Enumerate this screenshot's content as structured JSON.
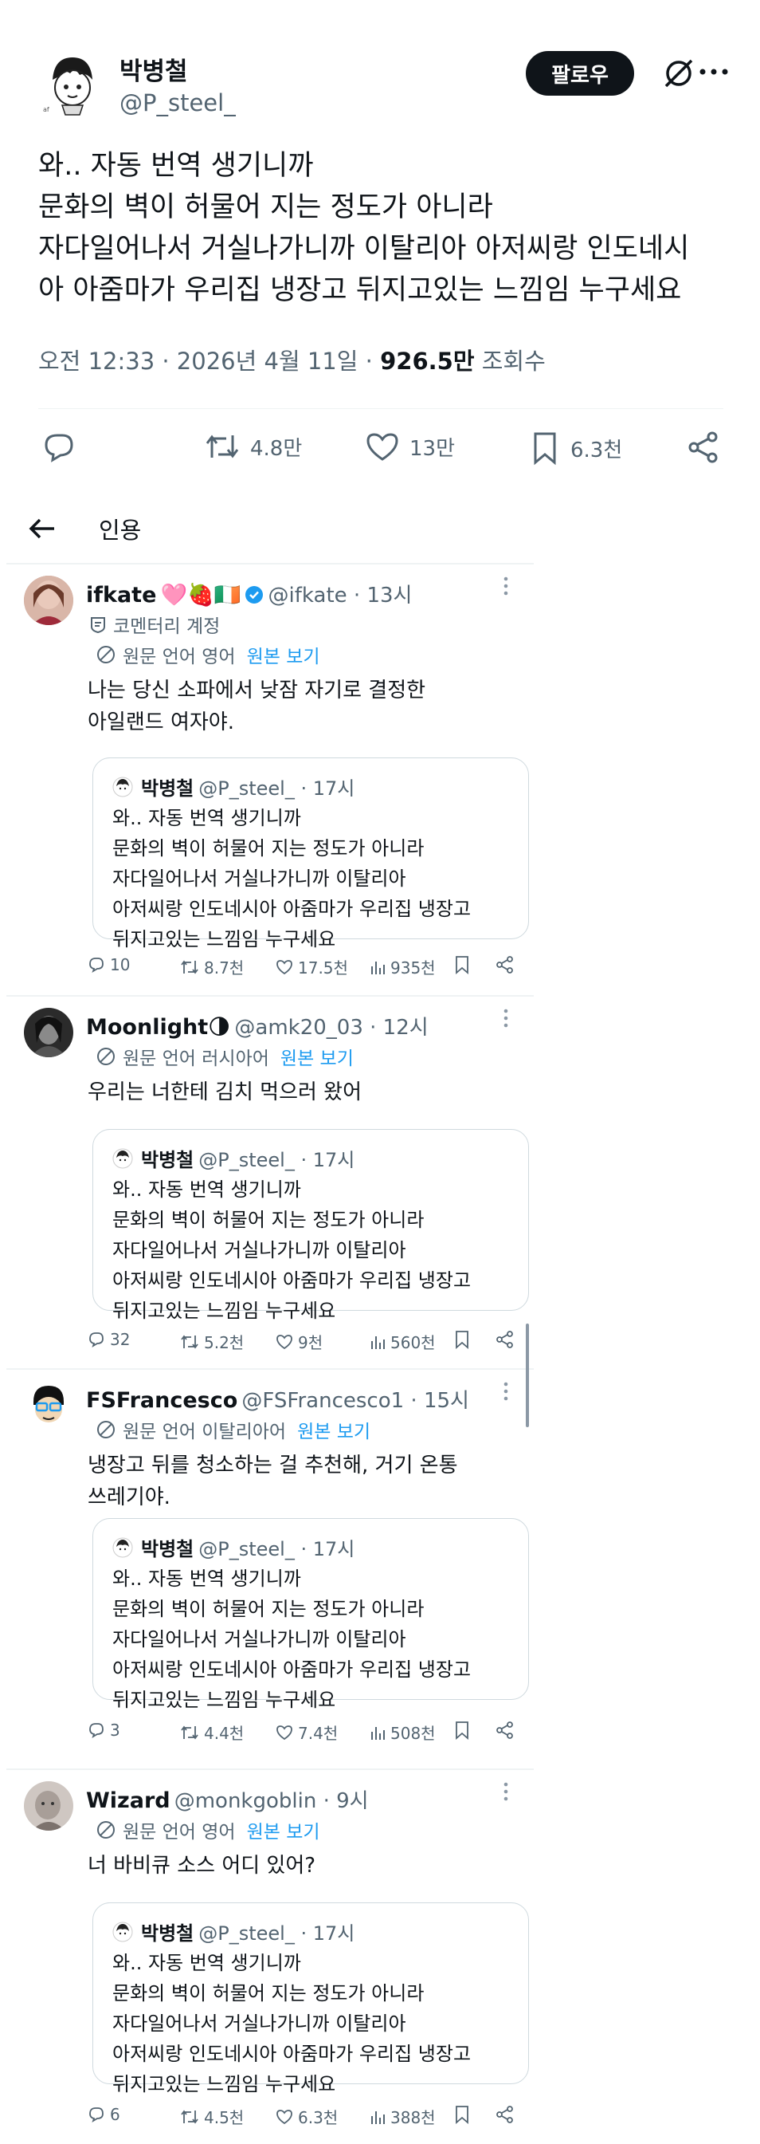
{
  "main": {
    "author_name": "박병철",
    "author_handle": "@P_steel_",
    "follow_label": "팔로우",
    "text": "와.. 자동 번역 생기니까\n문화의 벽이 허물어 지는 정도가 아니라\n자다일어나서 거실나가니까 이탈리아 아저씨랑 인도네시\n아 아줌마가 우리집 냉장고 뒤지고있는 느낌임 누구세요",
    "timestamp": "오전 12:33 · 2026년 4월 11일 · ",
    "views_count": "926.5만",
    "views_label": " 조회수",
    "retweets": "4.8만",
    "likes": "13만",
    "bookmarks": "6.3천"
  },
  "quotes_header": {
    "title": "인용"
  },
  "quoted": {
    "name": "박병철",
    "handle": "@P_steel_ · 17시",
    "text": "와.. 자동 번역 생기니까\n문화의 벽이 허물어 지는 정도가 아니라\n자다일어나서 거실나가니까 이탈리아\n아저씨랑 인도네시아 아줌마가 우리집 냉장고\n뒤지고있는 느낌임 누구세요"
  },
  "replies": [
    {
      "name": "ifkate",
      "emoji": "🩷🍓🇮🇪",
      "verified": true,
      "handle": "@ifkate · 13시",
      "subtitle": "코멘터리 계정",
      "translation": "원문 언어 영어",
      "show_original": "원본 보기",
      "text": "나는 당신 소파에서 낮잠 자기로 결정한\n아일랜드 여자야.",
      "stats": {
        "replies": "10",
        "retweets": "8.7천",
        "likes": "17.5천",
        "views": "935천"
      }
    },
    {
      "name": "Moonlight",
      "emoji": "🌗",
      "verified": false,
      "handle": "@amk20_03 · 12시",
      "translation": "원문 언어 러시아어",
      "show_original": "원본 보기",
      "text": "우리는 너한테 김치 먹으러 왔어",
      "stats": {
        "replies": "32",
        "retweets": "5.2천",
        "likes": "9천",
        "views": "560천"
      }
    },
    {
      "name": "FSFrancesco",
      "emoji": "",
      "verified": false,
      "handle": "@FSFrancesco1 · 15시",
      "translation": "원문 언어 이탈리아어",
      "show_original": "원본 보기",
      "text": "냉장고 뒤를 청소하는 걸 추천해, 거기 온통\n쓰레기야.",
      "stats": {
        "replies": "3",
        "retweets": "4.4천",
        "likes": "7.4천",
        "views": "508천"
      }
    },
    {
      "name": "Wizard",
      "emoji": "",
      "verified": false,
      "handle": "@monkgoblin · 9시",
      "translation": "원문 언어 영어",
      "show_original": "원본 보기",
      "text": "너 바비큐 소스 어디 있어?",
      "stats": {
        "replies": "6",
        "retweets": "4.5천",
        "likes": "6.3천",
        "views": "388천"
      }
    }
  ],
  "colors": {
    "accent": "#1d9bf0",
    "text": "#0f1419",
    "muted": "#536471",
    "border": "#cfd9de"
  }
}
